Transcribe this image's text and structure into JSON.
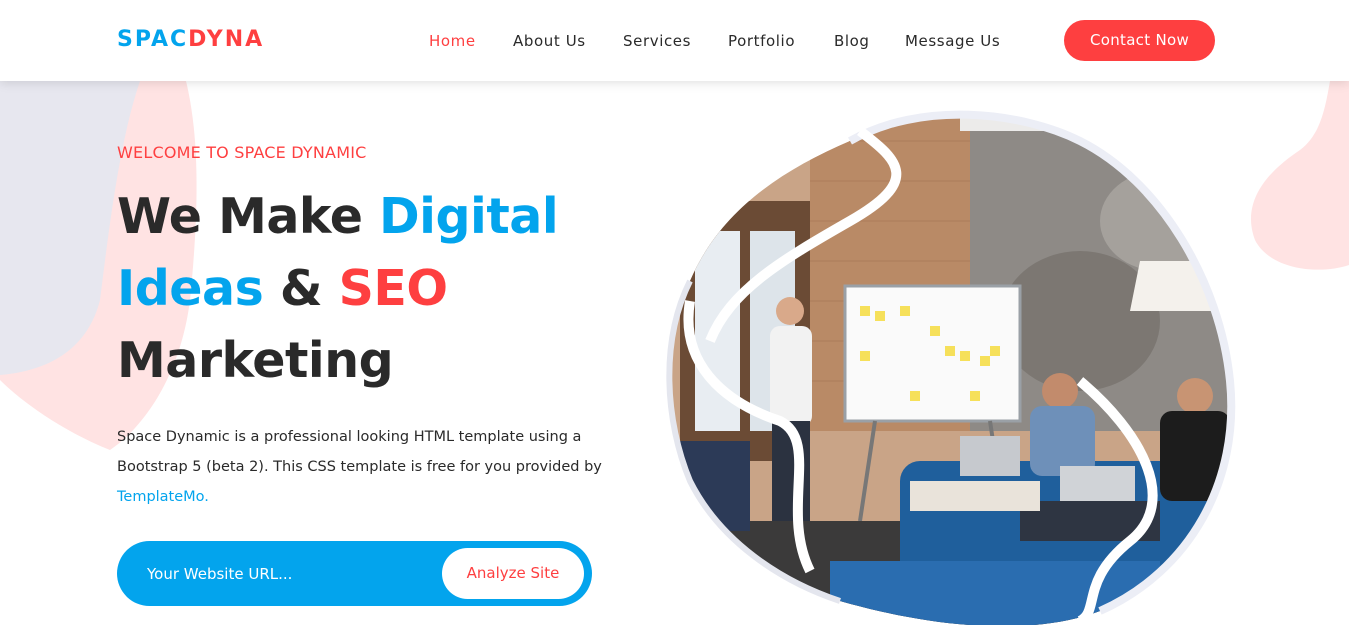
{
  "colors": {
    "primary_blue": "#03a4ed",
    "accent_red": "#fe3f40",
    "text_dark": "#2a2a2a",
    "blob_red": "#ffe3e3",
    "blob_gray": "#e6e6ee"
  },
  "brand": {
    "part1": "SPAC",
    "part2": "DYNA"
  },
  "nav": {
    "items": [
      {
        "label": "Home",
        "active": true
      },
      {
        "label": "About Us"
      },
      {
        "label": "Services"
      },
      {
        "label": "Portfolio"
      },
      {
        "label": "Blog"
      },
      {
        "label": "Message Us"
      }
    ],
    "cta": "Contact Now"
  },
  "hero": {
    "welcome": "WELCOME TO SPACE DYNAMIC",
    "headline": {
      "w1": "We Make ",
      "w2": "Digital",
      "w3": "Ideas",
      "w4": " & ",
      "w5": "SEO",
      "w6": "Marketing"
    },
    "description": "Space Dynamic is a professional looking HTML template using a Bootstrap 5 (beta 2). This CSS template is free for you provided by ",
    "link": "TemplateMo.",
    "input_placeholder": "Your Website URL...",
    "button": "Analyze Site",
    "image_icon": "office-meeting-photo"
  }
}
